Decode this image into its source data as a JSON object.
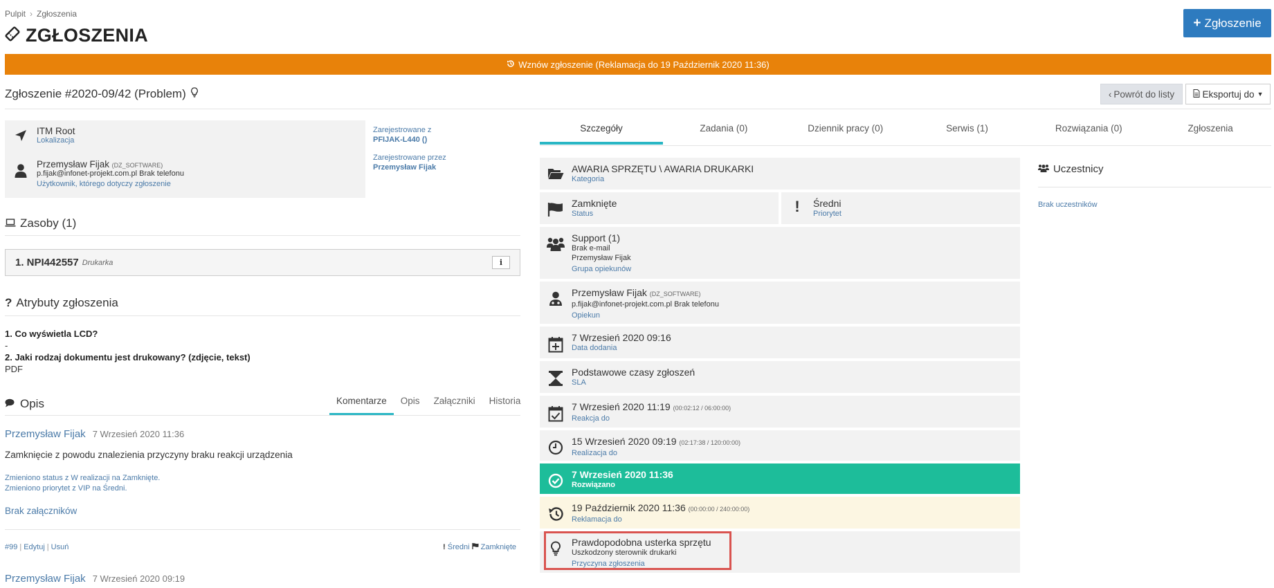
{
  "breadcrumb": {
    "home": "Pulpit",
    "sep": "›",
    "current": "Zgłoszenia"
  },
  "page_title": "ZGŁOSZENIA",
  "add_button": "Zgłoszenie",
  "banner": "Wznów zgłoszenie (Reklamacja do 19 Październik 2020 11:36)",
  "ticket_title": "Zgłoszenie #2020-09/42 (Problem)",
  "back_button": "Powrót do listy",
  "export_button": "Eksportuj do",
  "info": {
    "location_name": "ITM Root",
    "location_label": "Lokalizacja",
    "user_name": "Przemysław Fijak",
    "user_tag": "(DZ_SOFTWARE)",
    "user_contact": "p.fijak@infonet-projekt.com.pl Brak telefonu",
    "user_label": "Użytkownik, którego dotyczy zgłoszenie",
    "registered_from_label": "Zarejestrowane z",
    "registered_from_value": "PFIJAK-L440 ()",
    "registered_by_label": "Zarejestrowane przez",
    "registered_by_value": "Przemysław Fijak"
  },
  "resources": {
    "title": "Zasoby (1)",
    "item_name": "1. NPI442557",
    "item_type": "Drukarka",
    "info_button": "i"
  },
  "attributes": {
    "title": "Atrybuty zgłoszenia",
    "q1": "1. Co wyświetla LCD?",
    "a1": "-",
    "q2": "2. Jaki rodzaj dokumentu jest drukowany? (zdjęcie, tekst)",
    "a2": "PDF"
  },
  "description": {
    "title": "Opis",
    "tabs": [
      "Komentarze",
      "Opis",
      "Załączniki",
      "Historia"
    ]
  },
  "comments": [
    {
      "author": "Przemysław Fijak",
      "date": "7 Wrzesień 2020 11:36",
      "text": "Zamknięcie z powodu znalezienia przyczyny braku reakcji urządzenia",
      "log1": "Zmieniono status z W realizacji na Zamknięte.",
      "log2": "Zmieniono priorytet z VIP na Średni.",
      "attachments": "Brak załączników",
      "id": "#99",
      "edit": "Edytuj",
      "delete": "Usuń",
      "priority": "Średni",
      "status": "Zamknięte"
    },
    {
      "author": "Przemysław Fijak",
      "date": "7 Wrzesień 2020 09:19"
    }
  ],
  "main_tabs": [
    "Szczegóły",
    "Zadania (0)",
    "Dziennik pracy (0)",
    "Serwis (1)",
    "Rozwiązania (0)",
    "Zgłoszenia"
  ],
  "details": {
    "category_value": "AWARIA SPRZĘTU \\ AWARIA DRUKARKI",
    "category_label": "Kategoria",
    "status_value": "Zamknięte",
    "status_label": "Status",
    "priority_value": "Średni",
    "priority_label": "Priorytet",
    "group_value": "Support (1)",
    "group_email": "Brak e-mail",
    "group_member": "Przemysław Fijak",
    "group_label": "Grupa opiekunów",
    "owner_name": "Przemysław Fijak",
    "owner_tag": "(DZ_SOFTWARE)",
    "owner_contact": "p.fijak@infonet-projekt.com.pl Brak telefonu",
    "owner_label": "Opiekun",
    "added_value": "7 Wrzesień 2020 09:16",
    "added_label": "Data dodania",
    "sla_value": "Podstawowe czasy zgłoszeń",
    "sla_label": "SLA",
    "reaction_value": "7 Wrzesień 2020 11:19",
    "reaction_time": "(00:02:12 / 06:00:00)",
    "reaction_label": "Reakcja do",
    "realization_value": "15 Wrzesień 2020 09:19",
    "realization_time": "(02:17:38 / 120:00:00)",
    "realization_label": "Realizacja do",
    "solved_value": "7 Wrzesień 2020 11:36",
    "solved_label": "Rozwiązano",
    "complaint_value": "19 Październik 2020 11:36",
    "complaint_time": "(00:00:00 / 240:00:00)",
    "complaint_label": "Reklamacja do",
    "cause_value": "Prawdopodobna usterka sprzętu",
    "cause_detail": "Uszkodzony sterownik drukarki",
    "cause_label": "Przyczyna zgłoszenia"
  },
  "participants": {
    "title": "Uczestnicy",
    "empty": "Brak uczestników"
  },
  "colors": {
    "accent": "#2e7bbf",
    "banner": "#e8820a",
    "tab_active": "#29b6c4",
    "solved": "#1dbd9a",
    "complaint_bg": "#fcf6e2",
    "highlight": "#d9534f"
  }
}
